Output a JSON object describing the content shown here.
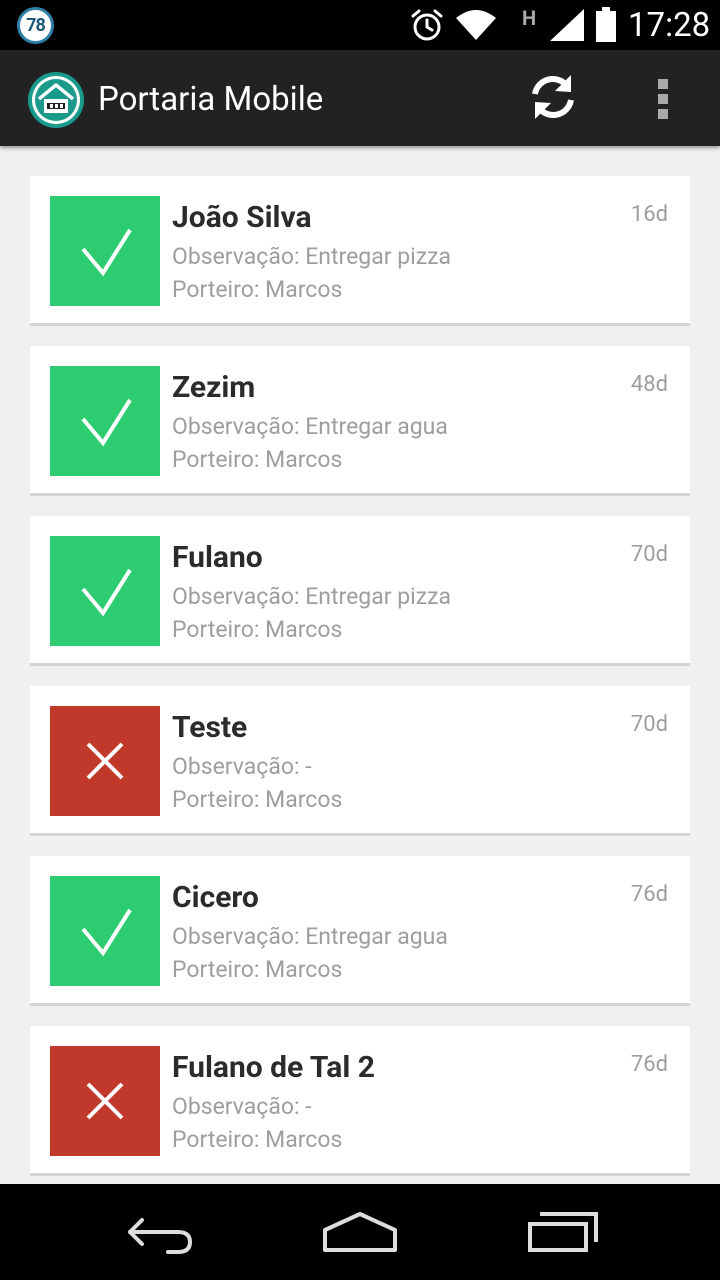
{
  "status_bar": {
    "notification_count": "78",
    "network_type": "H",
    "time": "17:28",
    "icons": [
      "alarm-icon",
      "wifi-icon",
      "signal-icon",
      "battery-icon"
    ]
  },
  "action_bar": {
    "title": "Portaria Mobile",
    "icons": [
      "app-logo-icon",
      "refresh-icon",
      "overflow-menu-icon"
    ]
  },
  "colors": {
    "ok": "#2ecc71",
    "fail": "#c0392b",
    "action_bar": "#222222",
    "background": "#f0f0f0"
  },
  "entries": [
    {
      "name": "João Silva",
      "observation": "Observação: Entregar pizza",
      "doorman": "Porteiro: Marcos",
      "age": "16d",
      "status": "ok"
    },
    {
      "name": "Zezim",
      "observation": "Observação: Entregar agua",
      "doorman": "Porteiro: Marcos",
      "age": "48d",
      "status": "ok"
    },
    {
      "name": "Fulano",
      "observation": "Observação: Entregar pizza",
      "doorman": "Porteiro: Marcos",
      "age": "70d",
      "status": "ok"
    },
    {
      "name": "Teste",
      "observation": "Observação: -",
      "doorman": "Porteiro: Marcos",
      "age": "70d",
      "status": "fail"
    },
    {
      "name": "Cicero",
      "observation": "Observação: Entregar agua",
      "doorman": "Porteiro: Marcos",
      "age": "76d",
      "status": "ok"
    },
    {
      "name": "Fulano de Tal 2",
      "observation": "Observação: -",
      "doorman": "Porteiro: Marcos",
      "age": "76d",
      "status": "fail"
    }
  ],
  "nav_bar": {
    "icons": [
      "back-icon",
      "home-icon",
      "recents-icon"
    ]
  }
}
